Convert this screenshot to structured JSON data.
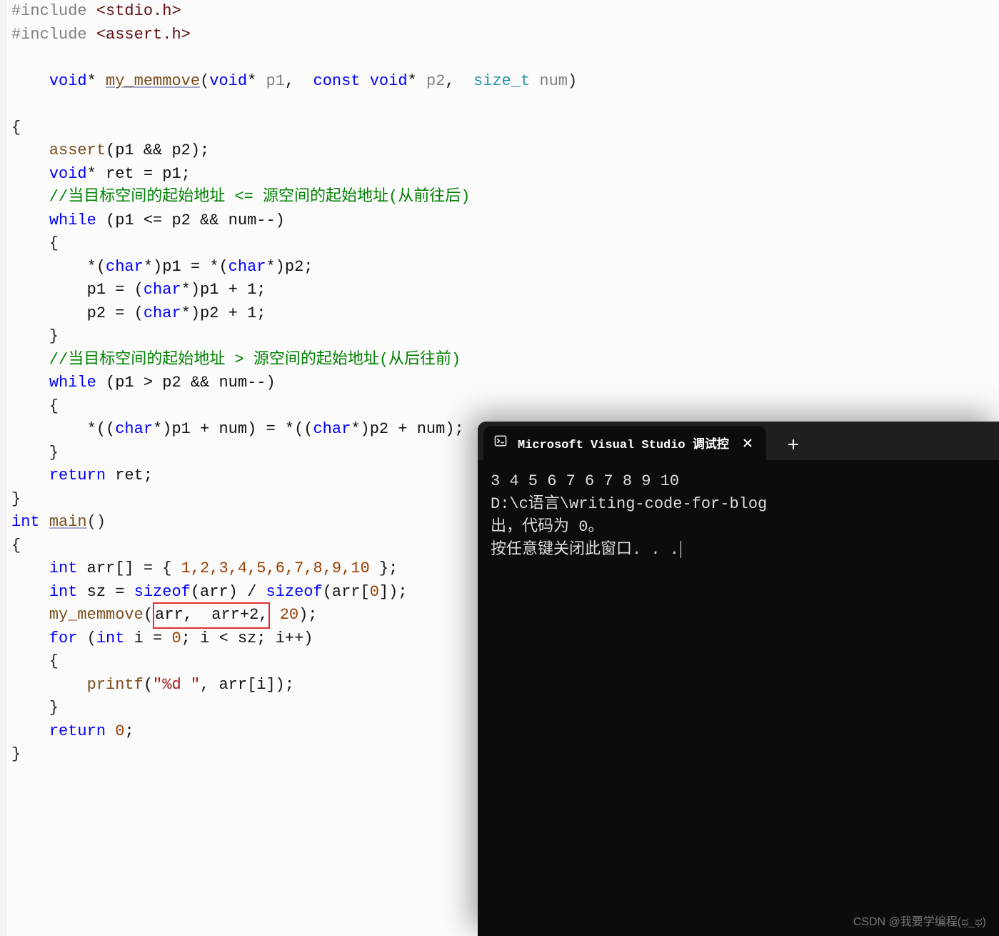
{
  "code": {
    "l1_pre": "#include ",
    "l1_file": "<stdio.h>",
    "l2_pre": "#include ",
    "l2_file": "<assert.h>",
    "l3": {
      "kw_void": "void",
      "star": "* ",
      "fname": "my_memmove",
      "lp": "(",
      "kw_void2": "void",
      "star2": "* ",
      "p1": "p1",
      "comma": ",  ",
      "kw_const": "const ",
      "kw_void3": "void",
      "star3": "* ",
      "p2": "p2",
      "comma2": ",  ",
      "size_t": "size_t",
      "sp": " ",
      "num": "num",
      "rp": ")"
    },
    "l4": "{",
    "l5": {
      "indent": "    ",
      "fname": "assert",
      "args": "(p1 && p2);"
    },
    "l6": {
      "indent": "    ",
      "kw": "void",
      "rest": "* ret = p1;"
    },
    "l7": "    //当目标空间的起始地址 <= 源空间的起始地址(从前往后)",
    "l8": {
      "indent": "    ",
      "kw": "while ",
      "lp": "(p1 <= p2 && num--)"
    },
    "l9": "    {",
    "l10": {
      "indent": "        ",
      "s1": "*(",
      "kw": "char",
      "s2": "*)p1 = *(",
      "kw2": "char",
      "s3": "*)p2;"
    },
    "l11": {
      "indent": "        ",
      "s1": "p1 = (",
      "kw": "char",
      "s2": "*)p1 + 1;"
    },
    "l12": {
      "indent": "        ",
      "s1": "p2 = (",
      "kw": "char",
      "s2": "*)p2 + 1;"
    },
    "l13": "    }",
    "l14": "    //当目标空间的起始地址 > 源空间的起始地址(从后往前)",
    "l15": {
      "indent": "    ",
      "kw": "while ",
      "lp": "(p1 > p2 && num--)"
    },
    "l16": "    {",
    "l17": {
      "indent": "        ",
      "s1": "*((",
      "kw": "char",
      "s2": "*)p1 + num) = *((",
      "kw2": "char",
      "s3": "*)p2 + num);"
    },
    "l18": "    }",
    "l19": {
      "indent": "    ",
      "kw": "return",
      "rest": " ret;"
    },
    "l20": "}",
    "blank1": "",
    "l21": {
      "kw": "int",
      "sp": " ",
      "fname": "main",
      "p": "()"
    },
    "l22": "{",
    "l23": {
      "indent": "    ",
      "kw": "int ",
      "var": "arr[] = { ",
      "nums": "1,2,3,4,5,6,7,8,9,10",
      "end": " };"
    },
    "l24": {
      "indent": "    ",
      "kw": "int ",
      "var": "sz = ",
      "kw2": "sizeof",
      "a": "(arr) / ",
      "kw3": "sizeof",
      "b": "(arr[",
      "zero": "0",
      "c": "]);"
    },
    "l25": {
      "indent": "    ",
      "fname": "my_memmove",
      "lp": "(",
      "box": "arr,  arr+2,",
      "rest": " 20);",
      "twenty": "20"
    },
    "l26": {
      "indent": "    ",
      "kw": "for ",
      "lp": "(",
      "kw2": "int ",
      "var": "i = ",
      "z": "0",
      "mid": "; i < sz; i++)"
    },
    "l27": "    {",
    "l28": {
      "indent": "        ",
      "fname": "printf",
      "lp": "(",
      "str": "\"%d \"",
      "rest": ", arr[i]);"
    },
    "l29": "    }",
    "l30": {
      "indent": "    ",
      "kw": "return",
      "sp": " ",
      "z": "0",
      "semi": ";"
    },
    "l31": "}"
  },
  "terminal": {
    "tab_title": "Microsoft Visual Studio 调试控",
    "output_line1": "3 4 5 6 7 6 7 8 9 10",
    "output_line2": "D:\\c语言\\writing-code-for-blog",
    "output_line3": "出，代码为 0。",
    "output_line4": "按任意键关闭此窗口. . ."
  },
  "watermark": "CSDN @我要学编程(ಥ_ಥ)"
}
